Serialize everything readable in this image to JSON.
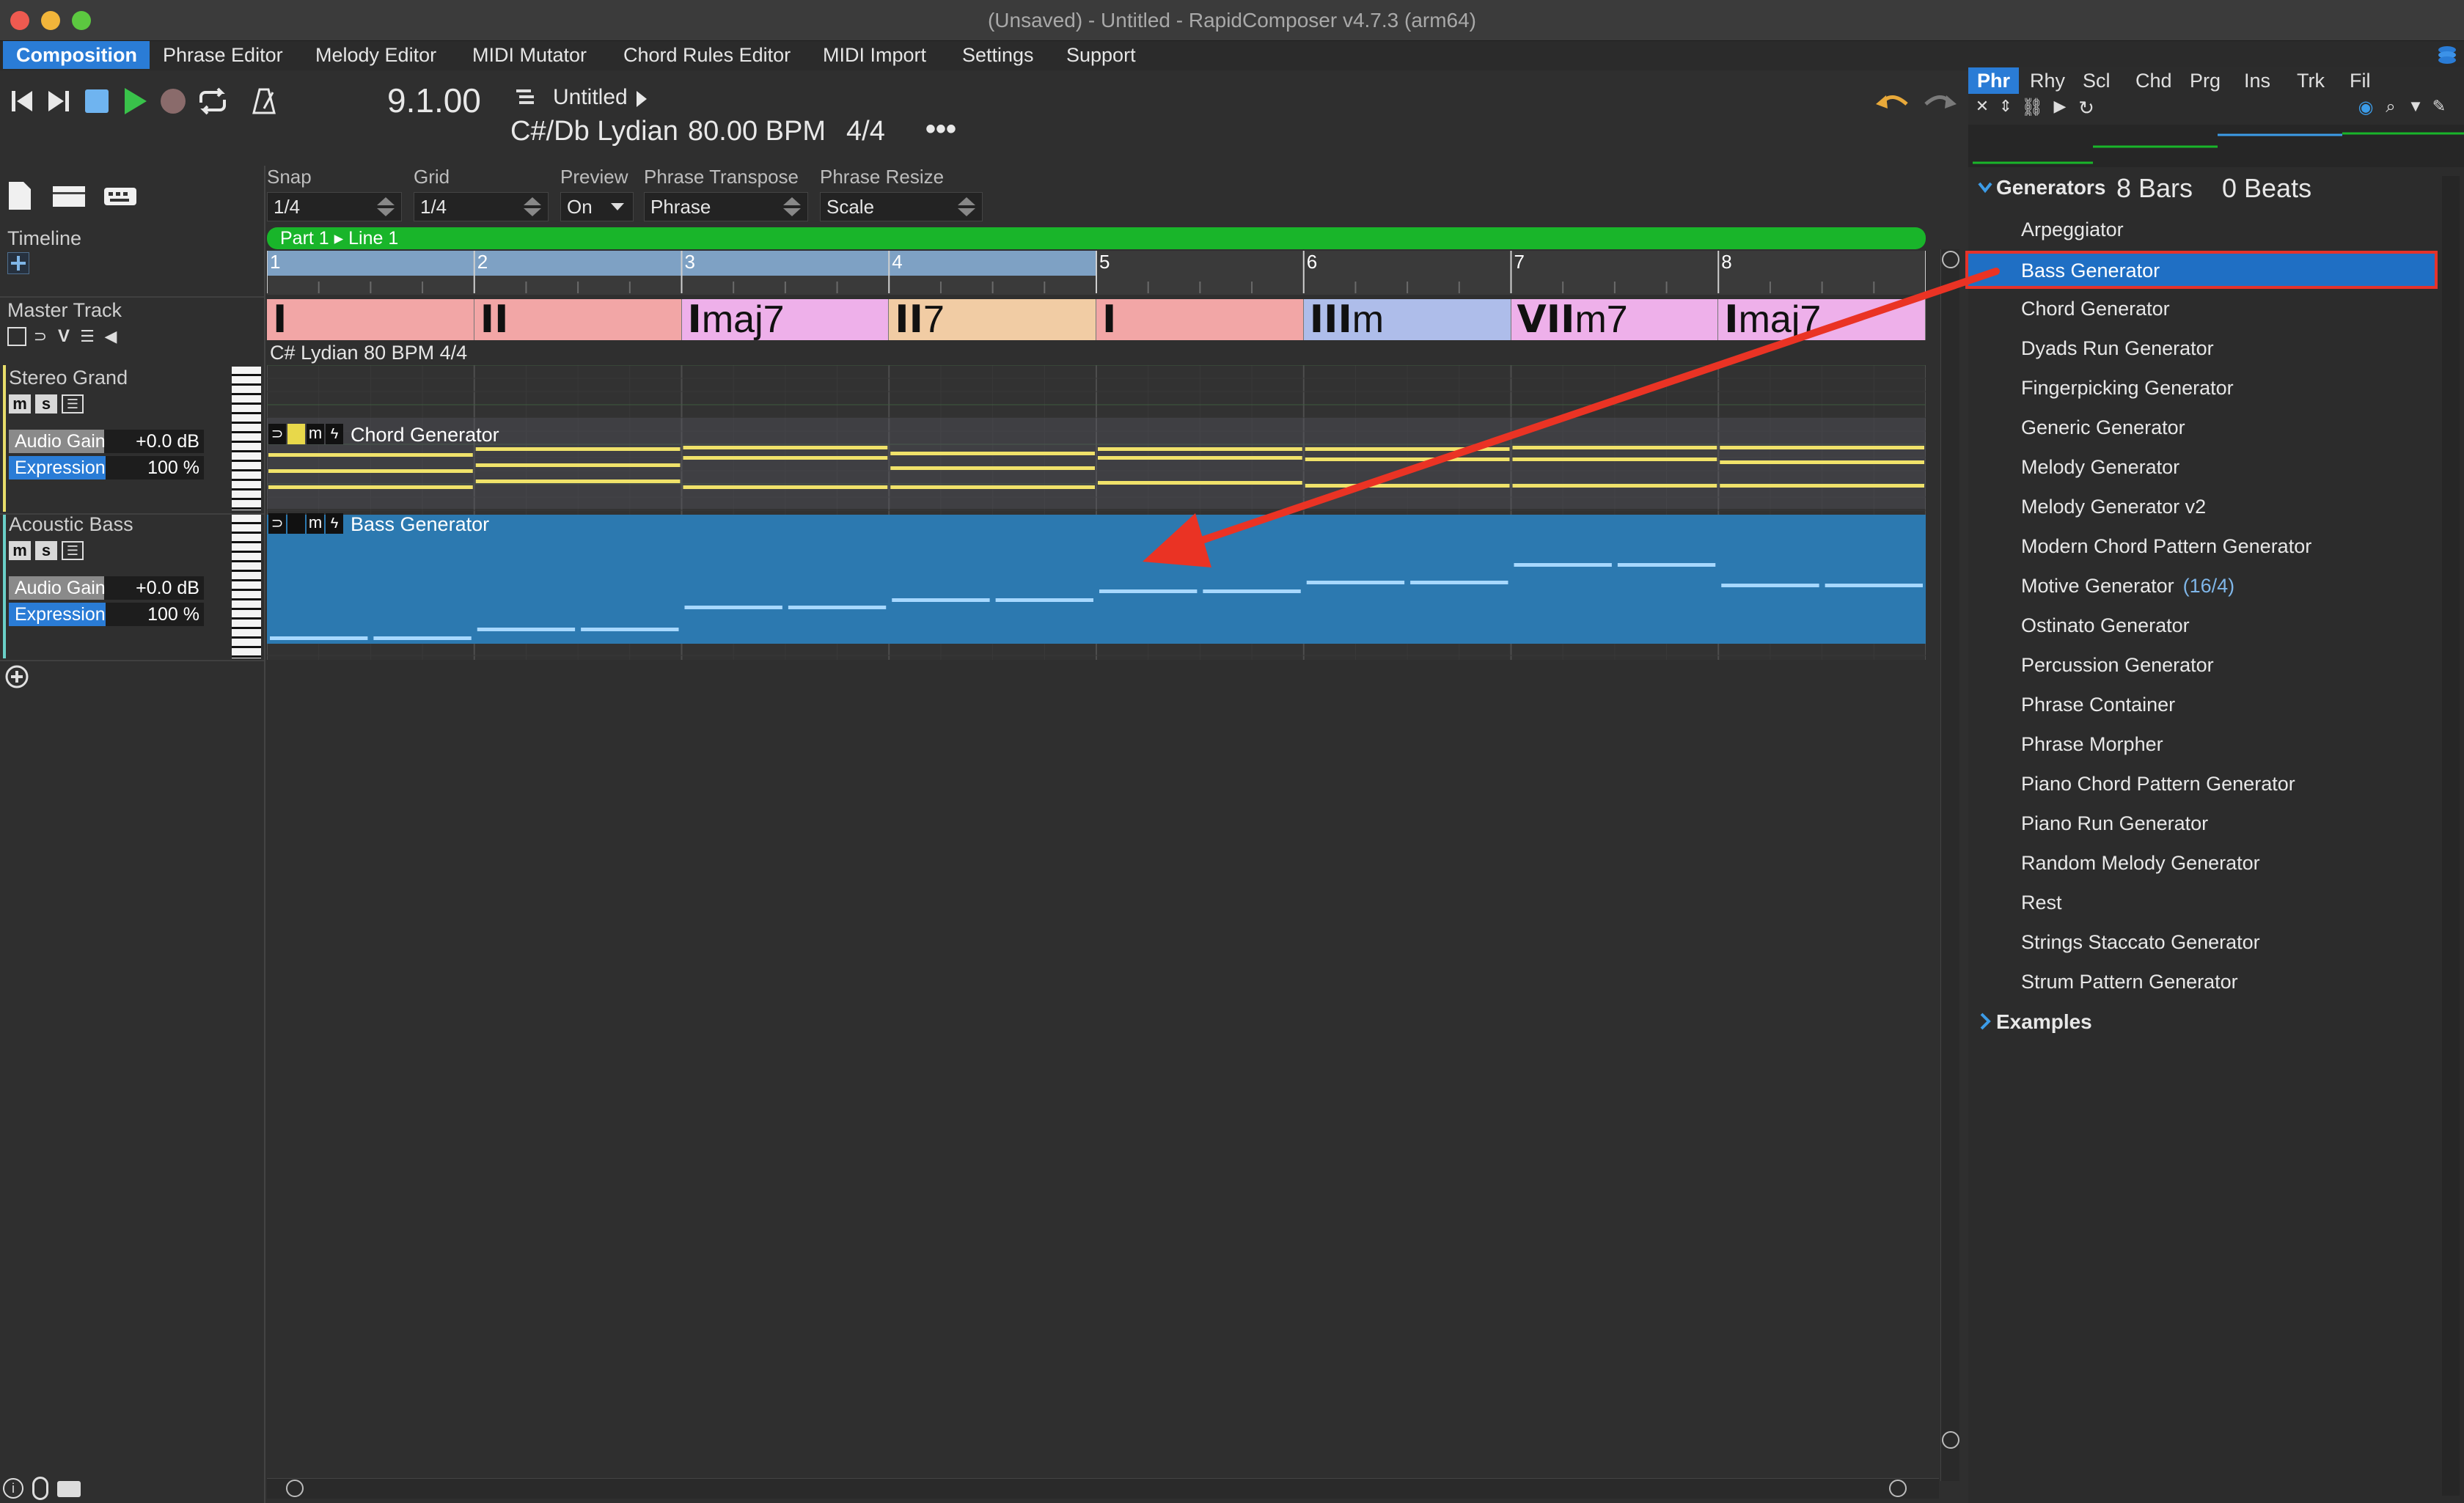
{
  "window": {
    "title": "(Unsaved) - Untitled - RapidComposer v4.7.3 (arm64)"
  },
  "menu": [
    {
      "label": "Composition",
      "active": true
    },
    {
      "label": "Phrase Editor"
    },
    {
      "label": "Melody Editor"
    },
    {
      "label": "MIDI Mutator"
    },
    {
      "label": "Chord Rules Editor"
    },
    {
      "label": "MIDI Import"
    },
    {
      "label": "Settings"
    },
    {
      "label": "Support"
    }
  ],
  "transport": {
    "position": "9.1.00",
    "project_name": "Untitled",
    "key_info": "C#/Db Lydian",
    "tempo": "80.00 BPM",
    "time_signature": "4/4",
    "more": "•••"
  },
  "controls": {
    "snap_label": "Snap",
    "snap_value": "1/4",
    "grid_label": "Grid",
    "grid_value": "1/4",
    "preview_label": "Preview",
    "preview_value": "On",
    "transpose_label": "Phrase Transpose",
    "transpose_value": "Phrase",
    "resize_label": "Phrase Resize",
    "resize_value": "Scale"
  },
  "left": {
    "timeline_label": "Timeline",
    "master_label": "Master Track",
    "master_buttons": [
      "V"
    ],
    "tracks": [
      {
        "name": "Stereo Grand",
        "gain_label": "Audio Gain",
        "gain_value": "+0.0 dB",
        "expr_label": "Expression",
        "expr_value": "100 %"
      },
      {
        "name": "Acoustic Bass",
        "gain_label": "Audio Gain",
        "gain_value": "+0.0 dB",
        "expr_label": "Expression",
        "expr_value": "100 %"
      }
    ],
    "ms_labels": [
      "m",
      "s"
    ]
  },
  "timeline": {
    "part_label": "Part 1 ▸ Line 1",
    "bars": [
      "1",
      "2",
      "3",
      "4",
      "5",
      "6",
      "7",
      "8"
    ],
    "key_text": "C# Lydian 80 BPM 4/4"
  },
  "chords": [
    {
      "roman": "I",
      "quality": "",
      "color": "#f2a6a6"
    },
    {
      "roman": "II",
      "quality": "",
      "color": "#f2a6a6"
    },
    {
      "roman": "I",
      "quality": "maj7",
      "color": "#eeb0ea"
    },
    {
      "roman": "II",
      "quality": "7",
      "color": "#f1cca4"
    },
    {
      "roman": "I",
      "quality": "",
      "color": "#f2a6a6"
    },
    {
      "roman": "III",
      "quality": "m",
      "color": "#aebdea"
    },
    {
      "roman": "VII",
      "quality": "m7",
      "color": "#eeb0ea"
    },
    {
      "roman": "I",
      "quality": "maj7",
      "color": "#eeb0ea"
    }
  ],
  "phrases": {
    "chord_gen": "Chord Generator",
    "bass_gen": "Bass Generator",
    "phrase_icon_m": "m"
  },
  "right": {
    "tabs": [
      "Phr",
      "Rhy",
      "Scl",
      "Chd",
      "Prg",
      "Ins",
      "Trk",
      "Fil"
    ],
    "section": "Generators",
    "length_bars": "8 Bars",
    "length_beats": "0 Beats",
    "items": [
      "Arpeggiator",
      "Bass Generator",
      "Chord Generator",
      "Dyads Run Generator",
      "Fingerpicking Generator",
      "Generic Generator",
      "Melody Generator",
      "Melody Generator v2",
      "Modern Chord Pattern Generator",
      "Motive Generator",
      "Ostinato Generator",
      "Percussion Generator",
      "Phrase Container",
      "Phrase Morpher",
      "Piano Chord Pattern Generator",
      "Piano Run Generator",
      "Random Melody Generator",
      "Rest",
      "Strings Staccato Generator",
      "Strum Pattern Generator"
    ],
    "motive_suffix": "(16/4)",
    "examples": "Examples"
  },
  "colors": {
    "accent": "#2a7cd6",
    "timeline_green": "#19b52a",
    "highlight_red": "#e5332a",
    "bass_phrase": "#2c79b0"
  }
}
